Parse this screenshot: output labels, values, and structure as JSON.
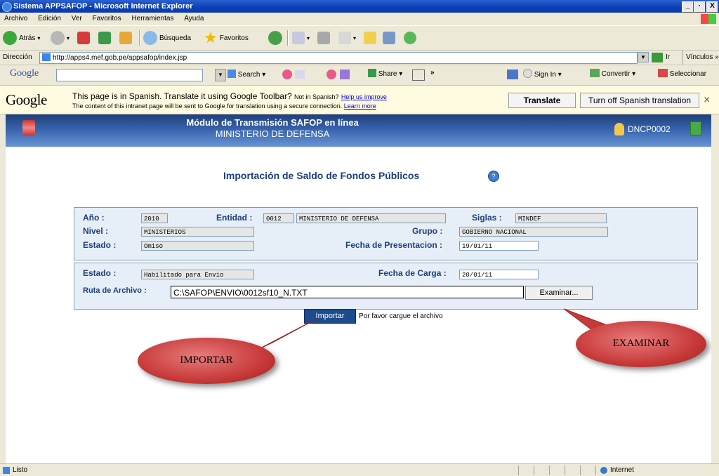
{
  "window": {
    "title": "Sistema APPSAFOP - Microsoft Internet Explorer",
    "controls": [
      "_",
      "·",
      "X"
    ]
  },
  "menu": [
    "Archivo",
    "Edición",
    "Ver",
    "Favoritos",
    "Herramientas",
    "Ayuda"
  ],
  "toolbar": {
    "back": "Atrás",
    "search": "Búsqueda",
    "favorites": "Favoritos"
  },
  "address": {
    "label": "Dirección",
    "url": "http://apps4.mef.gob.pe/appsafop/index.jsp",
    "go": "Ir",
    "links": "Vínculos"
  },
  "google_toolbar": {
    "logo": "Google",
    "search": "Search",
    "share": "Share",
    "signin": "Sign In",
    "convert": "Convertir",
    "select": "Seleccionar"
  },
  "translate_bar": {
    "logo": "Google",
    "message": "This page is in Spanish.  Translate it using Google Toolbar?",
    "not_spanish": "Not in Spanish?",
    "help_link": "Help us improve",
    "disclaimer": "The content of this intranet page will be sent to Google for translation using a secure connection.",
    "learn_more": "Learn more",
    "translate_btn": "Translate",
    "turn_off_btn": "Turn off Spanish translation",
    "close": "×"
  },
  "header": {
    "title": "Módulo de Transmisión SAFOP en línea",
    "subtitle": "MINISTERIO DE DEFENSA",
    "user": "DNCP0002"
  },
  "page_title": "Importación de Saldo de Fondos Públicos",
  "form1": {
    "anio_label": "Año :",
    "anio_value": "2010",
    "entidad_label": "Entidad :",
    "entidad_code": "0012",
    "entidad_name": "MINISTERIO DE DEFENSA",
    "siglas_label": "Siglas :",
    "siglas_value": "MINDEF",
    "nivel_label": "Nivel :",
    "nivel_value": "MINISTERIOS",
    "grupo_label": "Grupo :",
    "grupo_value": "GOBIERNO NACIONAL",
    "estado_label": "Estado :",
    "estado_value": "Omiso",
    "fecha_pres_label": "Fecha de Presentacion :",
    "fecha_pres_value": "19/01/11"
  },
  "form2": {
    "estado_label": "Estado :",
    "estado_value": "Habilitado para Envío",
    "fecha_carga_label": "Fecha de Carga :",
    "fecha_carga_value": "20/01/11",
    "ruta_label": "Ruta de Archivo :",
    "ruta_value": "C:\\SAFOP\\ENVIO\\0012sf10_N.TXT",
    "examinar": "Examinar..."
  },
  "import": {
    "button": "Importar",
    "note": "Por favor cargue el archivo"
  },
  "callouts": {
    "importar": "IMPORTAR",
    "examinar": "EXAMINAR"
  },
  "status": {
    "left": "Listo",
    "zone": "Internet"
  },
  "colors": {
    "header_bg": "#3a67b0",
    "label_blue": "#1c3e7c",
    "callout_red": "#c83a3a"
  }
}
